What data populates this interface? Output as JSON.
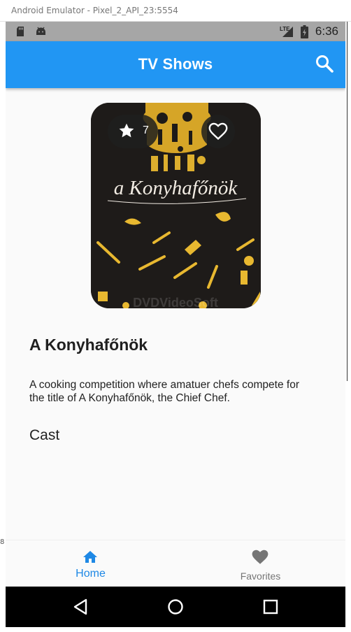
{
  "window": {
    "title": "Android Emulator - Pixel_2_API_23:5554"
  },
  "background": {
    "fragment": "8"
  },
  "status_bar": {
    "time": "6:36",
    "network": "LTE"
  },
  "app_bar": {
    "title": "TV Shows"
  },
  "show": {
    "name": "A Konyhafőnök",
    "rating": "7",
    "description": "A cooking competition where amatuer chefs compete for the title of A Konyhafőnök, the Chief Chef.",
    "poster_text": "a Konyhafőnök",
    "poster_watermark": "DVDVideoSoft"
  },
  "sections": {
    "cast_heading": "Cast"
  },
  "bottom_nav": {
    "items": [
      {
        "label": "Home",
        "icon": "home-icon",
        "active": true
      },
      {
        "label": "Favorites",
        "icon": "heart-icon",
        "active": false
      }
    ],
    "active_color": "#1e88e5",
    "inactive_color": "#757575"
  },
  "colors": {
    "primary": "#2196f3",
    "poster_gold": "#e8b830",
    "poster_bg": "#1e1b19"
  }
}
